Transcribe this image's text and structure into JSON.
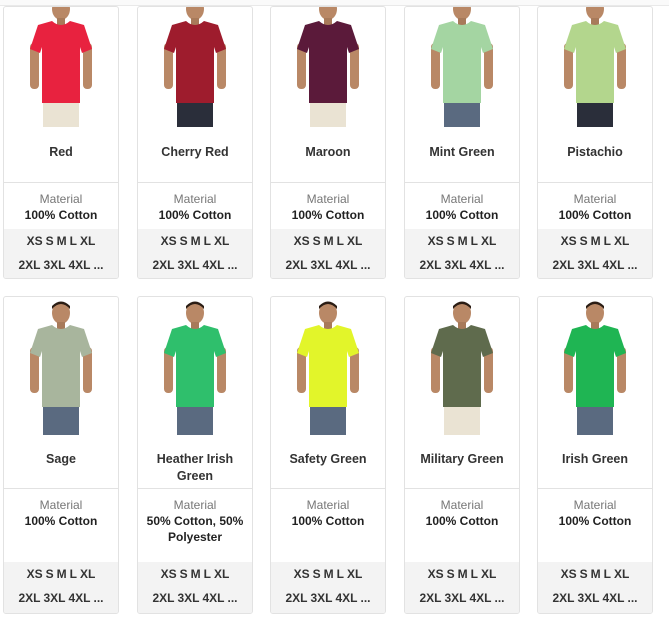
{
  "products": [
    {
      "name": "Red",
      "material_label": "Material",
      "material": "100% Cotton",
      "sizes_row1": [
        "XS",
        "S",
        "M",
        "L",
        "XL"
      ],
      "sizes_row2": [
        "2XL",
        "3XL",
        "4XL",
        "..."
      ],
      "shirt_color": "#e8223f",
      "pants_color": "#eae3d3"
    },
    {
      "name": "Cherry Red",
      "material_label": "Material",
      "material": "100% Cotton",
      "sizes_row1": [
        "XS",
        "S",
        "M",
        "L",
        "XL"
      ],
      "sizes_row2": [
        "2XL",
        "3XL",
        "4XL",
        "..."
      ],
      "shirt_color": "#9e1c2d",
      "pants_color": "#2a2e3a"
    },
    {
      "name": "Maroon",
      "material_label": "Material",
      "material": "100% Cotton",
      "sizes_row1": [
        "XS",
        "S",
        "M",
        "L",
        "XL"
      ],
      "sizes_row2": [
        "2XL",
        "3XL",
        "4XL",
        "..."
      ],
      "shirt_color": "#5b1a3a",
      "pants_color": "#eae3d3"
    },
    {
      "name": "Mint Green",
      "material_label": "Material",
      "material": "100% Cotton",
      "sizes_row1": [
        "XS",
        "S",
        "M",
        "L",
        "XL"
      ],
      "sizes_row2": [
        "2XL",
        "3XL",
        "4XL",
        "..."
      ],
      "shirt_color": "#a4d5a2",
      "pants_color": "#5a6a80"
    },
    {
      "name": "Pistachio",
      "material_label": "Material",
      "material": "100% Cotton",
      "sizes_row1": [
        "XS",
        "S",
        "M",
        "L",
        "XL"
      ],
      "sizes_row2": [
        "2XL",
        "3XL",
        "4XL",
        "..."
      ],
      "shirt_color": "#b3d68d",
      "pants_color": "#2a2e3a"
    },
    {
      "name": "Sage",
      "material_label": "Material",
      "material": "100% Cotton",
      "sizes_row1": [
        "XS",
        "S",
        "M",
        "L",
        "XL"
      ],
      "sizes_row2": [
        "2XL",
        "3XL",
        "4XL",
        "..."
      ],
      "shirt_color": "#a8b59d",
      "pants_color": "#5a6a80"
    },
    {
      "name": "Heather Irish Green",
      "material_label": "Material",
      "material": "50% Cotton, 50% Polyester",
      "sizes_row1": [
        "XS",
        "S",
        "M",
        "L",
        "XL"
      ],
      "sizes_row2": [
        "2XL",
        "3XL",
        "4XL",
        "..."
      ],
      "shirt_color": "#2fbf6c",
      "pants_color": "#5a6a80"
    },
    {
      "name": "Safety Green",
      "material_label": "Material",
      "material": "100% Cotton",
      "sizes_row1": [
        "XS",
        "S",
        "M",
        "L",
        "XL"
      ],
      "sizes_row2": [
        "2XL",
        "3XL",
        "4XL",
        "..."
      ],
      "shirt_color": "#e2f52a",
      "pants_color": "#5a6a80"
    },
    {
      "name": "Military Green",
      "material_label": "Material",
      "material": "100% Cotton",
      "sizes_row1": [
        "XS",
        "S",
        "M",
        "L",
        "XL"
      ],
      "sizes_row2": [
        "2XL",
        "3XL",
        "4XL",
        "..."
      ],
      "shirt_color": "#5f6b4d",
      "pants_color": "#eae3d3"
    },
    {
      "name": "Irish Green",
      "material_label": "Material",
      "material": "100% Cotton",
      "sizes_row1": [
        "XS",
        "S",
        "M",
        "L",
        "XL"
      ],
      "sizes_row2": [
        "2XL",
        "3XL",
        "4XL",
        "..."
      ],
      "shirt_color": "#1fb553",
      "pants_color": "#5a6a80"
    }
  ]
}
